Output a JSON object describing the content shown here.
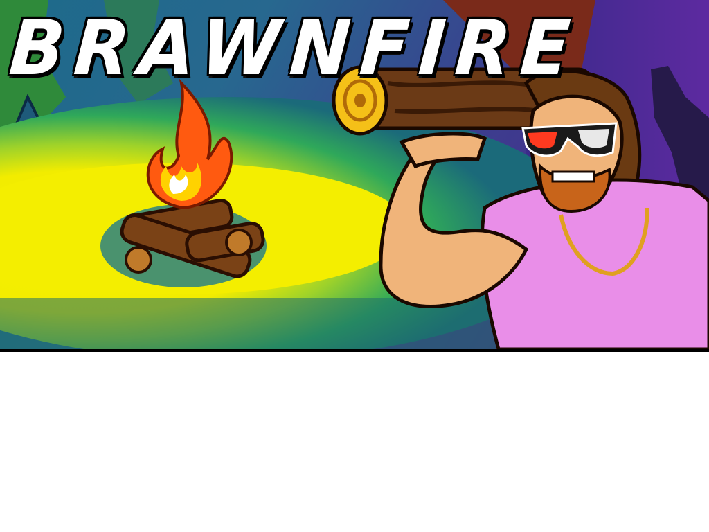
{
  "game": {
    "title": "BRAWNFIRE"
  },
  "colors": {
    "sky_left": "#2a3a8a",
    "sky_right": "#5a2a9a",
    "ground_light": "#f4f000",
    "ground_mid": "#3fb84a",
    "shirt": "#e98ee8",
    "skin": "#f0b47a",
    "flame_outer": "#ff6a10",
    "flame_inner": "#ffd200",
    "log": "#6b3a16"
  },
  "icons": {
    "campfire": "campfire-icon",
    "hero": "bearded-strongman"
  }
}
